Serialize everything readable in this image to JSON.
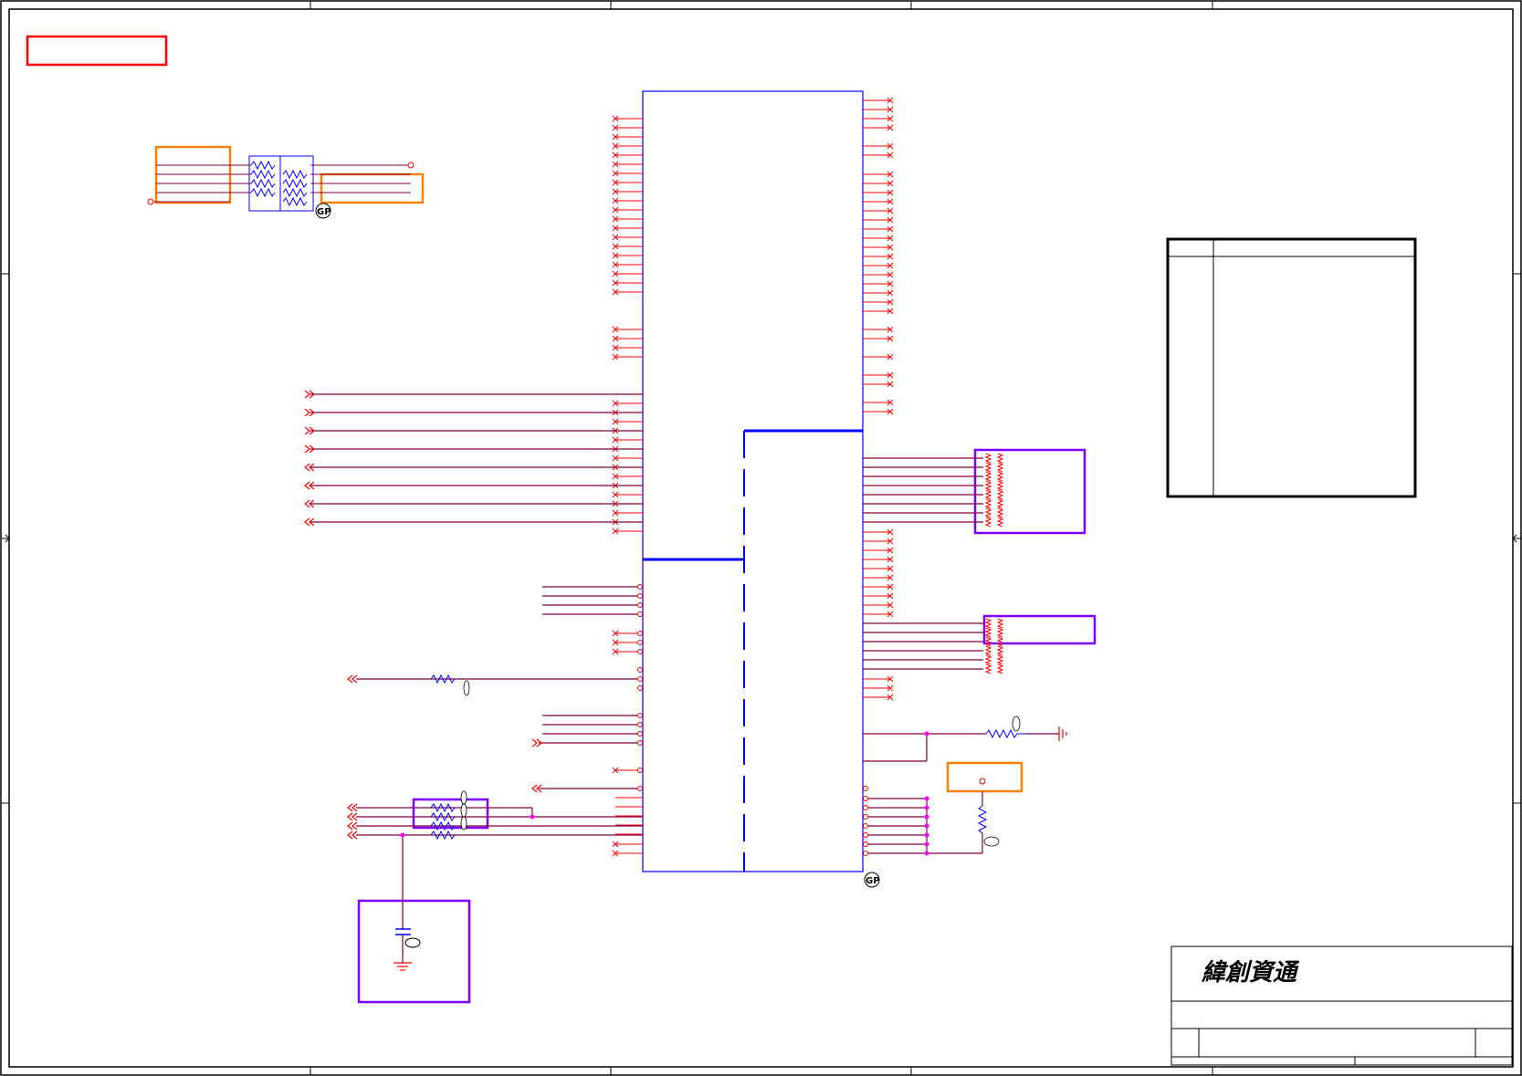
{
  "title_block": {
    "company_logo": "緯創資通"
  },
  "badges": {
    "green_part": "GP"
  },
  "colors": {
    "border": "#000000",
    "component": "#0000ff",
    "wire": "#ff0000",
    "net": "#800040",
    "junction": "#ff00ff",
    "highlight_red": "#ff0000",
    "highlight_orange": "#ff8000",
    "highlight_purple": "#8000ff"
  },
  "icons": {
    "resistor": "resistor-icon",
    "capacitor": "capacitor-icon",
    "ground": "ground-icon",
    "no_connect": "no-connect-icon",
    "offpage_connector": "offpage-connector-icon",
    "gp_badge": "gp-badge-icon"
  }
}
